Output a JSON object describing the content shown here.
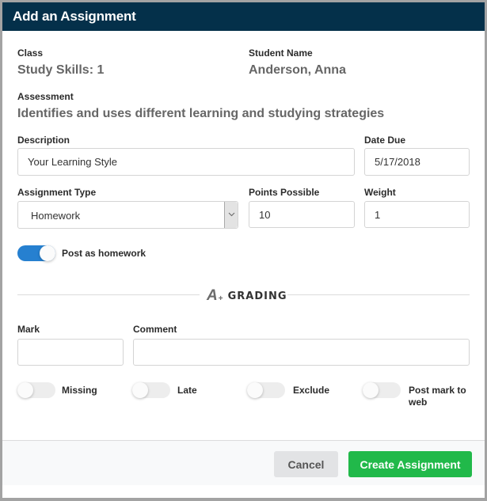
{
  "modal": {
    "title": "Add an Assignment"
  },
  "info": {
    "class_label": "Class",
    "class_value": "Study Skills: 1",
    "student_label": "Student Name",
    "student_value": "Anderson, Anna",
    "assessment_label": "Assessment",
    "assessment_value": "Identifies and uses different learning and studying strategies"
  },
  "form": {
    "description_label": "Description",
    "description_value": "Your Learning Style",
    "date_due_label": "Date Due",
    "date_due_value": "5/17/2018",
    "assignment_type_label": "Assignment Type",
    "assignment_type_value": "Homework",
    "points_label": "Points Possible",
    "points_value": "10",
    "weight_label": "Weight",
    "weight_value": "1",
    "post_homework_label": "Post as homework",
    "post_homework_on": true
  },
  "grading": {
    "icon": "a-plus-icon",
    "icon_text": "A",
    "icon_sup": "+",
    "title": "GRADING",
    "mark_label": "Mark",
    "mark_value": "",
    "comment_label": "Comment",
    "comment_value": "",
    "toggles": [
      {
        "label": "Missing",
        "on": false
      },
      {
        "label": "Late",
        "on": false
      },
      {
        "label": "Exclude",
        "on": false
      },
      {
        "label": "Post mark to web",
        "on": false
      }
    ]
  },
  "footer": {
    "cancel_label": "Cancel",
    "create_label": "Create Assignment"
  },
  "colors": {
    "header_bg": "#04304a",
    "toggle_on": "#2680d0",
    "primary_button": "#21b94a",
    "secondary_button": "#e2e3e5"
  }
}
